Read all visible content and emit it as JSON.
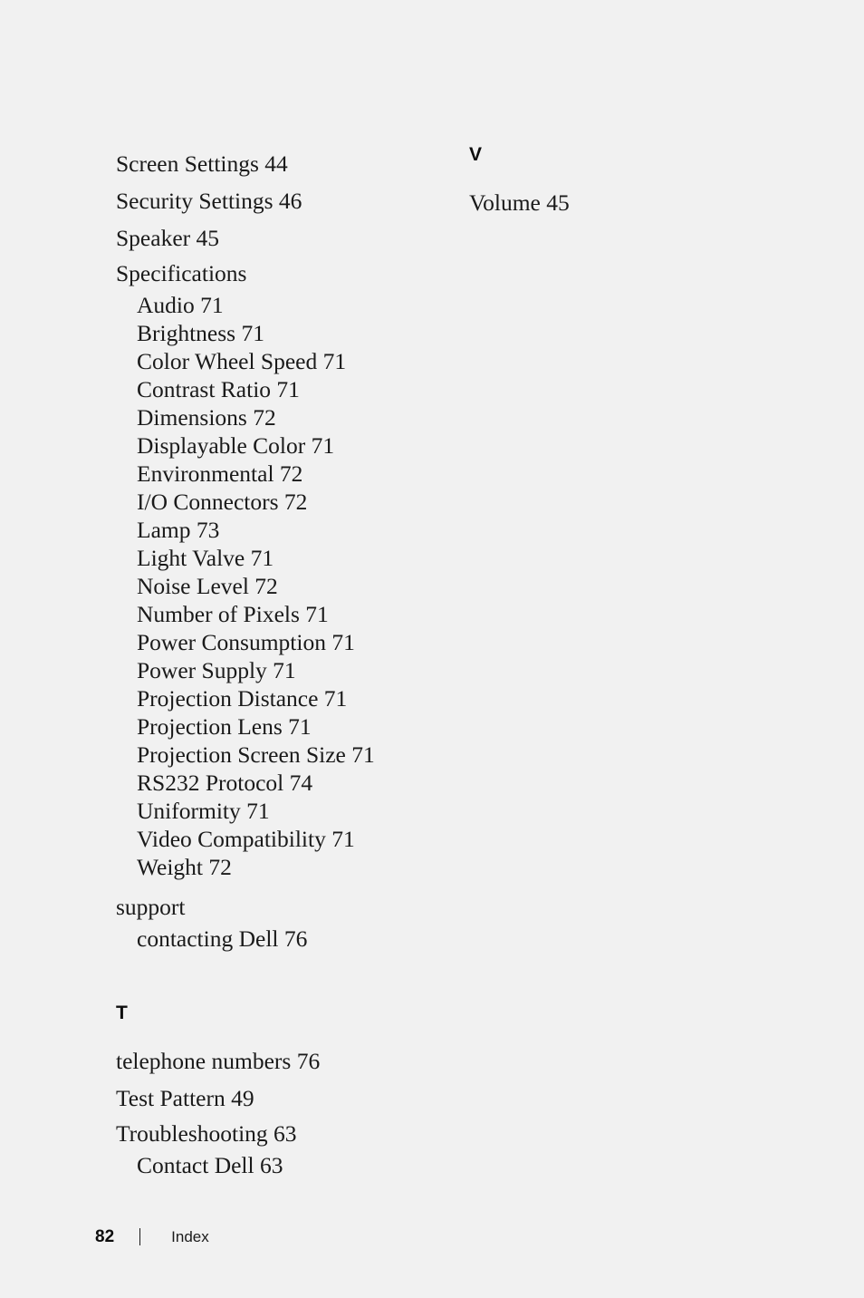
{
  "footer": {
    "page_number": "82",
    "section_label": "Index"
  },
  "columns": {
    "left": {
      "entries": [
        {
          "label": "Screen Settings 44"
        },
        {
          "label": "Security Settings 46"
        },
        {
          "label": "Speaker 45"
        },
        {
          "label": "Specifications",
          "children": [
            "Audio 71",
            "Brightness 71",
            "Color Wheel Speed 71",
            "Contrast Ratio 71",
            "Dimensions 72",
            "Displayable Color 71",
            "Environmental 72",
            "I/O Connectors 72",
            "Lamp 73",
            "Light Valve 71",
            "Noise Level 72",
            "Number of Pixels 71",
            "Power Consumption 71",
            "Power Supply 71",
            "Projection Distance 71",
            "Projection Lens 71",
            "Projection Screen Size 71",
            "RS232 Protocol 74",
            "Uniformity 71",
            "Video Compatibility 71",
            "Weight 72"
          ]
        },
        {
          "label": "support",
          "children": [
            "contacting Dell 76"
          ]
        }
      ],
      "section": {
        "heading": "T",
        "entries": [
          {
            "label": "telephone numbers 76"
          },
          {
            "label": "Test Pattern 49"
          },
          {
            "label": "Troubleshooting 63",
            "children": [
              "Contact Dell 63"
            ]
          }
        ]
      }
    },
    "right": {
      "heading": "V",
      "entries": [
        {
          "label": "Volume 45"
        }
      ]
    }
  }
}
